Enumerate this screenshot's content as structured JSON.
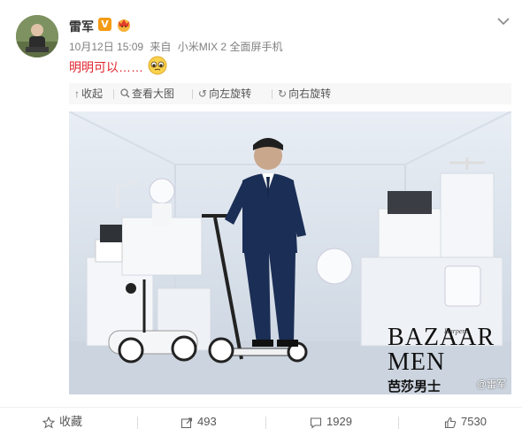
{
  "post": {
    "username": "雷军",
    "verified_badge": "V",
    "timestamp": "10月12日 15:09",
    "source_prefix": "来自",
    "source": "小米MIX 2 全面屏手机",
    "content": "明明可以……",
    "emoji_name": "pitiful-face-emoji"
  },
  "toolbar": {
    "collapse": "收起",
    "view_large": "查看大图",
    "rotate_left": "向左旋转",
    "rotate_right": "向右旋转"
  },
  "photo": {
    "magazine_title_line1": "BAZAAR",
    "magazine_title_line2": "MEN",
    "magazine_small": "Harper's",
    "magazine_chinese": "芭莎男士",
    "watermark": "@雷军"
  },
  "actions": {
    "favorite": "收藏",
    "repost_count": "493",
    "comment_count": "1929",
    "like_count": "7530"
  },
  "colors": {
    "content_red": "#e0262f",
    "badge_orange": "#f49b13"
  }
}
